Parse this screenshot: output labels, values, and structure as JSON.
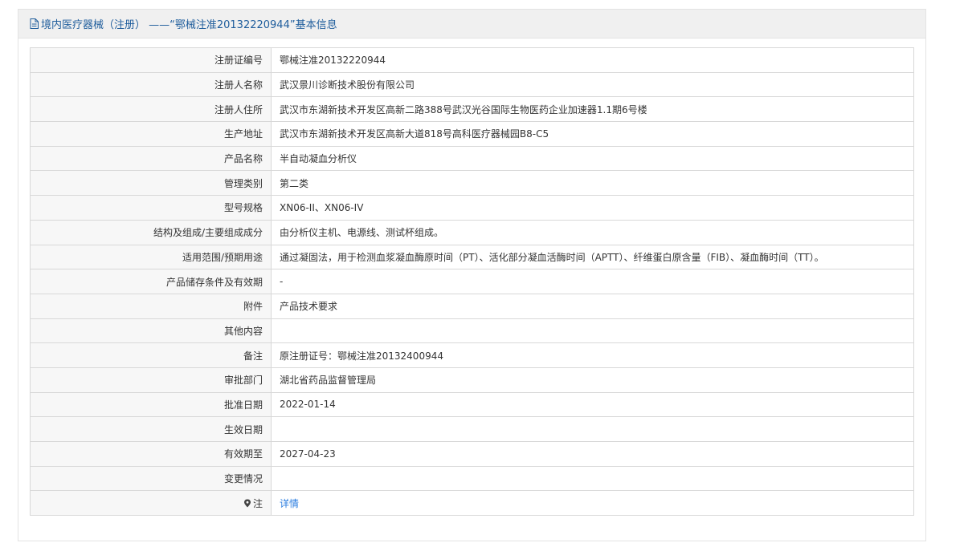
{
  "panel": {
    "title": "境内医疗器械（注册） ——“鄂械注准20132220944”基本信息",
    "accent_color": "#1f5d9c",
    "icon": "document-icon"
  },
  "rows": [
    {
      "label": "注册证编号",
      "value": "鄂械注准20132220944"
    },
    {
      "label": "注册人名称",
      "value": "武汉景川诊断技术股份有限公司"
    },
    {
      "label": "注册人住所",
      "value": "武汉市东湖新技术开发区高新二路388号武汉光谷国际生物医药企业加速器1.1期6号楼"
    },
    {
      "label": "生产地址",
      "value": "武汉市东湖新技术开发区高新大道818号高科医疗器械园B8-C5"
    },
    {
      "label": "产品名称",
      "value": "半自动凝血分析仪"
    },
    {
      "label": "管理类别",
      "value": "第二类"
    },
    {
      "label": "型号规格",
      "value": "XN06-II、XN06-IV"
    },
    {
      "label": "结构及组成/主要组成成分",
      "value": "由分析仪主机、电源线、测试杯组成。"
    },
    {
      "label": "适用范围/预期用途",
      "value": "通过凝固法，用于检测血浆凝血酶原时间（PT）、活化部分凝血活酶时间（APTT）、纤维蛋白原含量（FIB）、凝血酶时间（TT）。"
    },
    {
      "label": "产品储存条件及有效期",
      "value": "-"
    },
    {
      "label": "附件",
      "value": "产品技术要求"
    },
    {
      "label": "其他内容",
      "value": ""
    },
    {
      "label": "备注",
      "value": "原注册证号：鄂械注准20132400944"
    },
    {
      "label": "审批部门",
      "value": "湖北省药品监督管理局"
    },
    {
      "label": "批准日期",
      "value": "2022-01-14"
    },
    {
      "label": "生效日期",
      "value": ""
    },
    {
      "label": "有效期至",
      "value": "2027-04-23"
    },
    {
      "label": "变更情况",
      "value": ""
    }
  ],
  "note_row": {
    "icon": "pin-icon",
    "label": "注",
    "link_text": "详情",
    "link_color": "#2a7de0"
  }
}
